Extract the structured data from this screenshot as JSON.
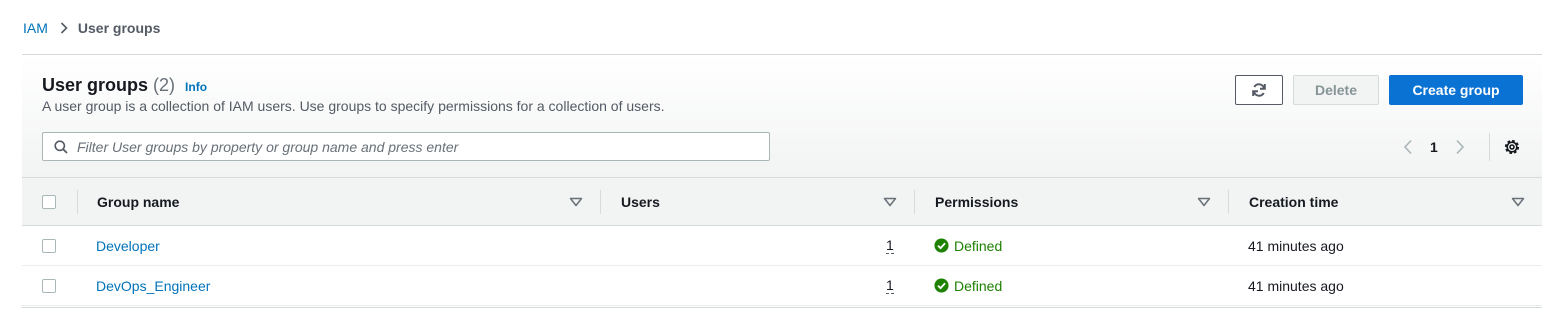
{
  "breadcrumb": {
    "root": "IAM",
    "current": "User groups"
  },
  "header": {
    "title": "User groups",
    "count": "(2)",
    "info": "Info",
    "description": "A user group is a collection of IAM users. Use groups to specify permissions for a collection of users."
  },
  "actions": {
    "refresh_icon": "refresh-icon",
    "delete_label": "Delete",
    "create_label": "Create group"
  },
  "search": {
    "placeholder": "Filter User groups by property or group name and press enter",
    "value": ""
  },
  "pagination": {
    "current_page": "1"
  },
  "table": {
    "columns": [
      "Group name",
      "Users",
      "Permissions",
      "Creation time"
    ],
    "rows": [
      {
        "name": "Developer",
        "users": "1",
        "permissions": "Defined",
        "created": "41 minutes ago"
      },
      {
        "name": "DevOps_Engineer",
        "users": "1",
        "permissions": "Defined",
        "created": "41 minutes ago"
      }
    ]
  },
  "colors": {
    "link": "#0073bb",
    "primary_button": "#0972d3",
    "success": "#1d8102",
    "header_bg": "#f2f3f3"
  }
}
